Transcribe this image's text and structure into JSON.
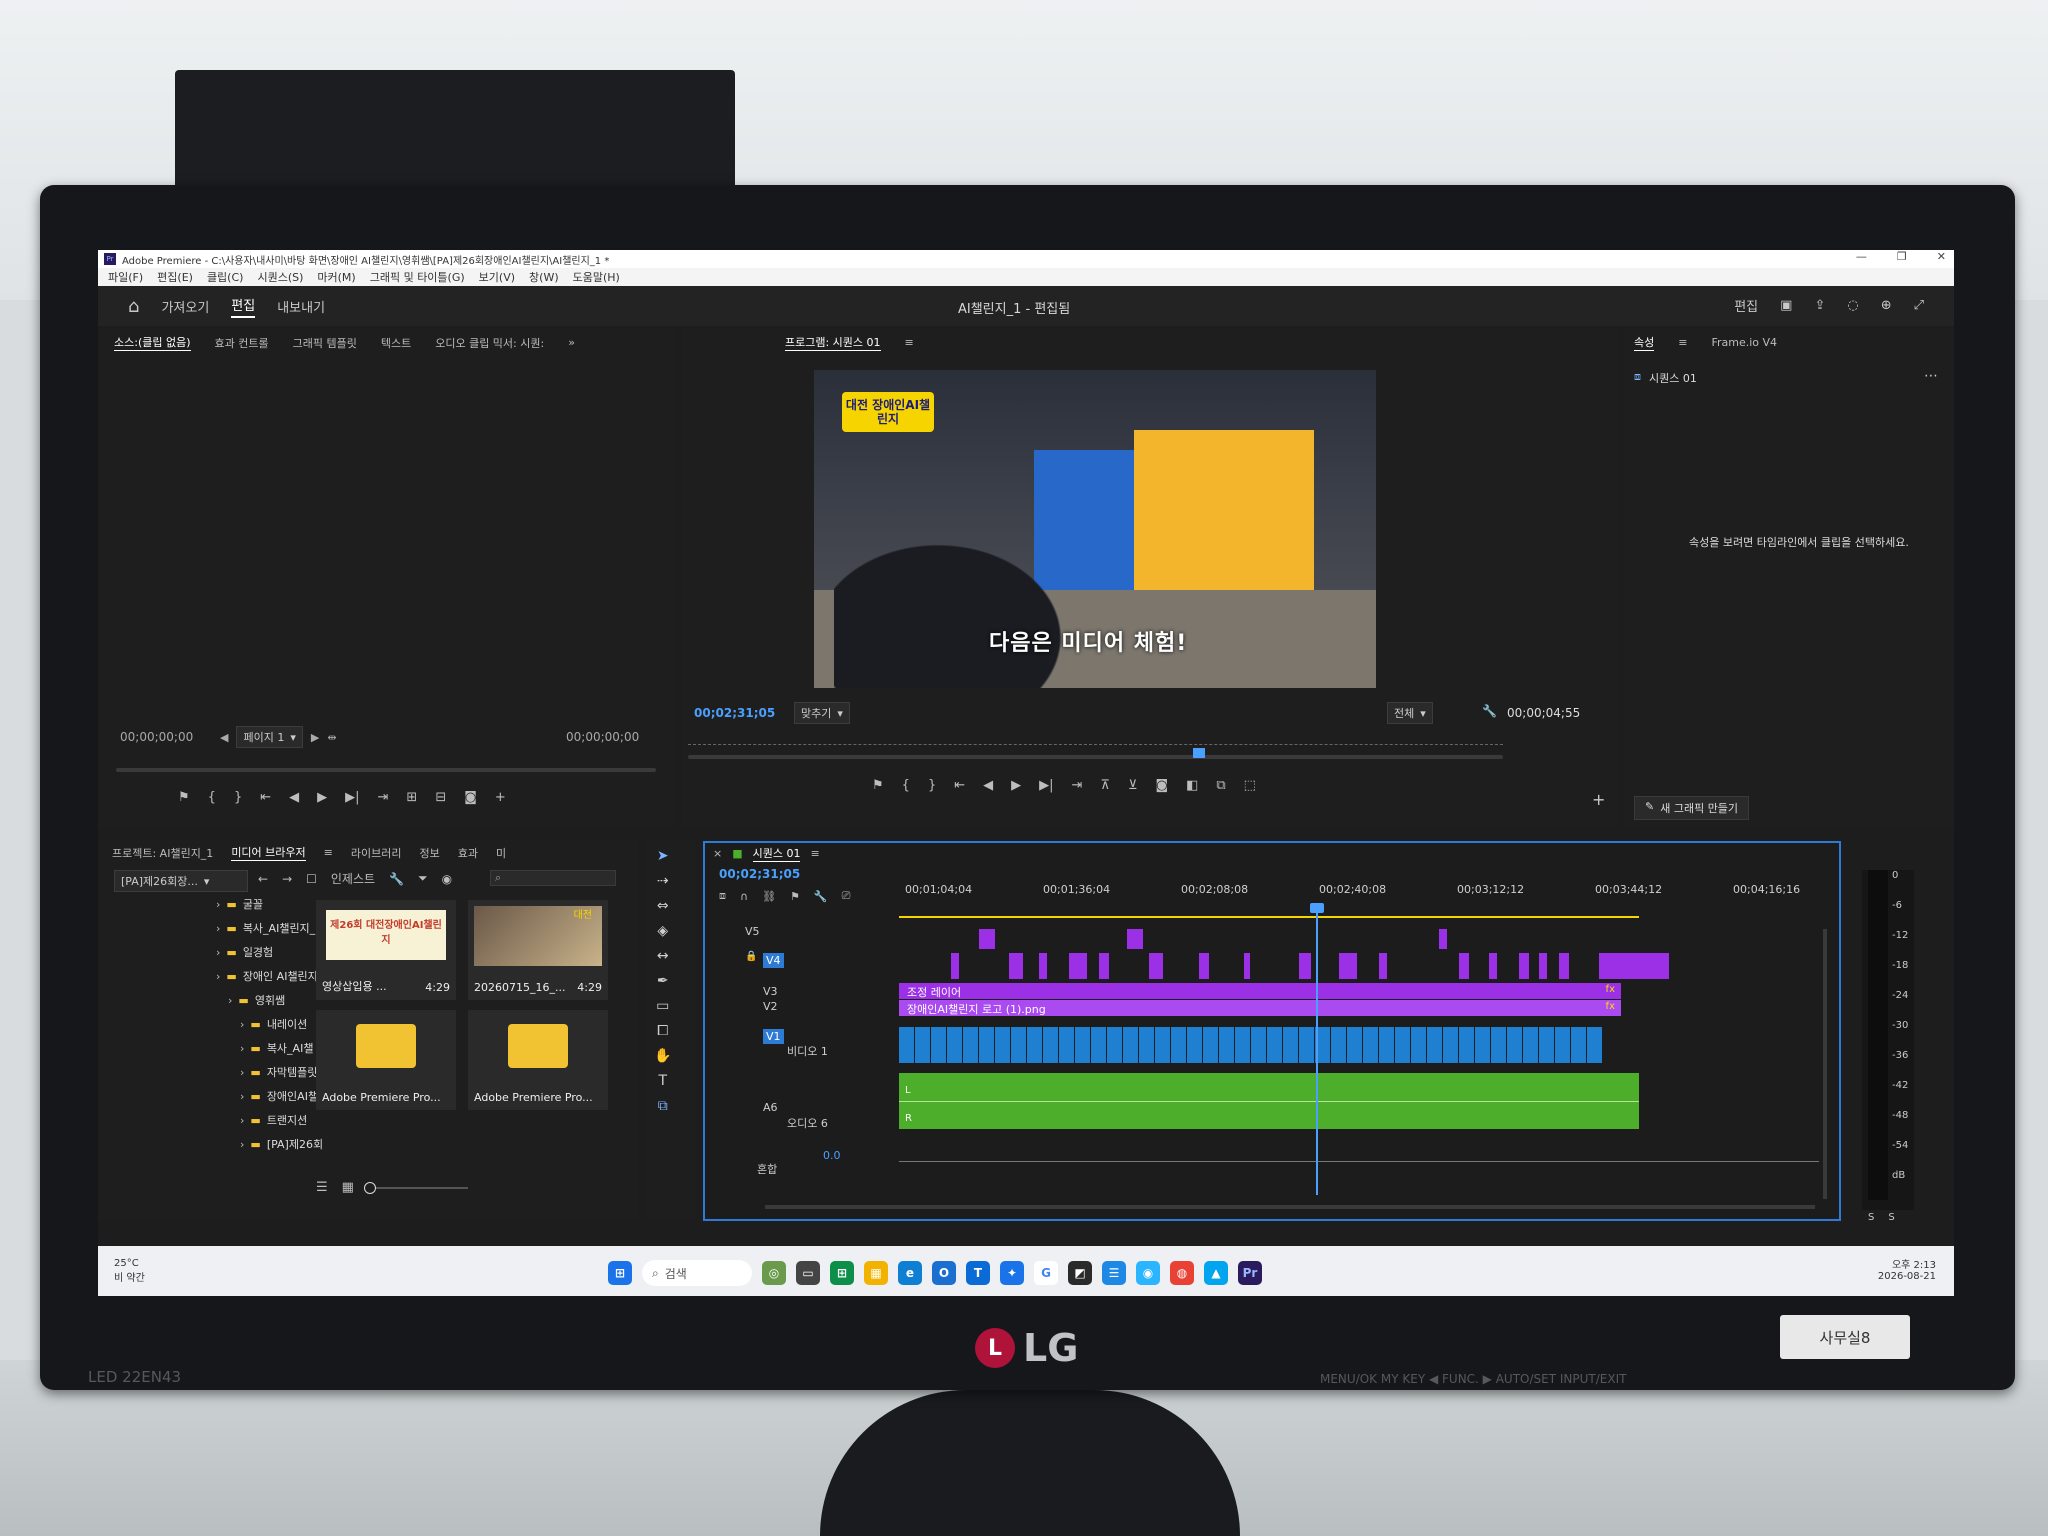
{
  "window": {
    "title": "Adobe Premiere - C:\\사용자\\내사미\\바탕 화면\\장애인 AI챌린지\\영휘쌤\\[PA]제26회장애인AI챌린지\\AI챌린지_1 *",
    "minimize": "—",
    "maximize": "❐",
    "close": "✕"
  },
  "menu": [
    "파일(F)",
    "편집(E)",
    "클립(C)",
    "시퀀스(S)",
    "마커(M)",
    "그래픽 및 타이틀(G)",
    "보기(V)",
    "창(W)",
    "도움말(H)"
  ],
  "header": {
    "nav": [
      "가져오기",
      "편집",
      "내보내기"
    ],
    "active_nav": "편집",
    "title": "AI챌린지_1 - 편집됨",
    "right_label": "편집"
  },
  "source_panel": {
    "tabs": [
      "소스:(클립 없음)",
      "효과 컨트롤",
      "그래픽 템플릿",
      "텍스트",
      "오디오 클립 믹서: 시퀀:"
    ],
    "tc_in": "00;00;00;00",
    "tc_out": "00;00;00;00",
    "page_select": "페이지 1"
  },
  "program_panel": {
    "tab": "프로그램: 시퀀스 01",
    "timecode": "00;02;31;05",
    "fit": "맞추기",
    "quality": "전체",
    "duration": "00;00;04;55",
    "overlay_logo": "대전 장애인AI챌린지",
    "subtitle": "다음은 미디어 체험!"
  },
  "properties_panel": {
    "tabs": [
      "속성",
      "Frame.io V4"
    ],
    "sequence": "시퀀스 01",
    "hint": "속성을 보려면 타임라인에서 클립을 선택하세요.",
    "new_graphic": "새 그래픽 만들기"
  },
  "project_panel": {
    "tabs": [
      "프로젝트: AI챌린지_1",
      "미디어 브라우저",
      "라이브러리",
      "정보",
      "효과",
      "미"
    ],
    "path_select": "[PA]제26회장...",
    "ingest": "인제스트",
    "folders": [
      {
        "name": "굴꼴",
        "depth": 3
      },
      {
        "name": "복사_AI챌린지_",
        "depth": 3
      },
      {
        "name": "일경험",
        "depth": 3
      },
      {
        "name": "장애인 AI챌린지",
        "depth": 3
      },
      {
        "name": "영휘쌤",
        "depth": 4
      },
      {
        "name": "내레이션",
        "depth": 5
      },
      {
        "name": "복사_AI챌",
        "depth": 5
      },
      {
        "name": "자막템플릿",
        "depth": 5
      },
      {
        "name": "장애인AI챌",
        "depth": 5
      },
      {
        "name": "트랜지션",
        "depth": 5
      },
      {
        "name": "[PA]제26회",
        "depth": 5
      }
    ],
    "thumbs": [
      {
        "name": "영상삽입용 ...",
        "dur": "4:29",
        "kind": "title",
        "overlay": "제26회 대전장애인AI챌린지"
      },
      {
        "name": "20260715_16_...",
        "dur": "4:29",
        "kind": "photo",
        "overlay": "대전"
      },
      {
        "name": "Adobe Premiere Pro...",
        "dur": "",
        "kind": "folder"
      },
      {
        "name": "Adobe Premiere Pro...",
        "dur": "",
        "kind": "folder"
      }
    ]
  },
  "timeline": {
    "tab": "시퀀스 01",
    "timecode": "00;02;31;05",
    "ruler": [
      "00;01;04;04",
      "00;01;36;04",
      "00;02;08;08",
      "00;02;40;08",
      "00;03;12;12",
      "00;03;44;12",
      "00;04;16;16"
    ],
    "tracks": {
      "v5": "V5",
      "v4": "V4",
      "v3": "V3",
      "v2": "V2",
      "v1": "V1",
      "v1_name": "비디오 1",
      "a6": "A6",
      "a6_name": "오디오 6",
      "mix": "혼합",
      "mix_value": "0.0"
    },
    "clips": {
      "v3": "조정 레이어",
      "v2": "장애인AI챌린지 로고 (1).png"
    },
    "fx": "fx"
  },
  "audio_meter": {
    "ticks": [
      "0",
      "-6",
      "-12",
      "-18",
      "-24",
      "-30",
      "-36",
      "-42",
      "-48",
      "-54",
      "dB"
    ],
    "solo": [
      "S",
      "S"
    ]
  },
  "taskbar": {
    "weather_temp": "25°C",
    "weather_desc": "비 약간",
    "search": "검색",
    "time": "오후 2:13",
    "date": "2026-08-21"
  },
  "monitor": {
    "brand": "LG",
    "model": "LED 22EN43",
    "sticker": "사무실8",
    "bezel_text": "MENU/OK   MY KEY ◀   FUNC. ▶   AUTO/SET   INPUT/EXIT"
  },
  "colors": {
    "accent_blue": "#2d7bd4",
    "timecode_blue": "#4aa0ff",
    "clip_purple": "#9b30e6",
    "clip_blue": "#1f7fd1",
    "clip_green": "#4cae2b",
    "playhead": "#4aa0ff"
  }
}
